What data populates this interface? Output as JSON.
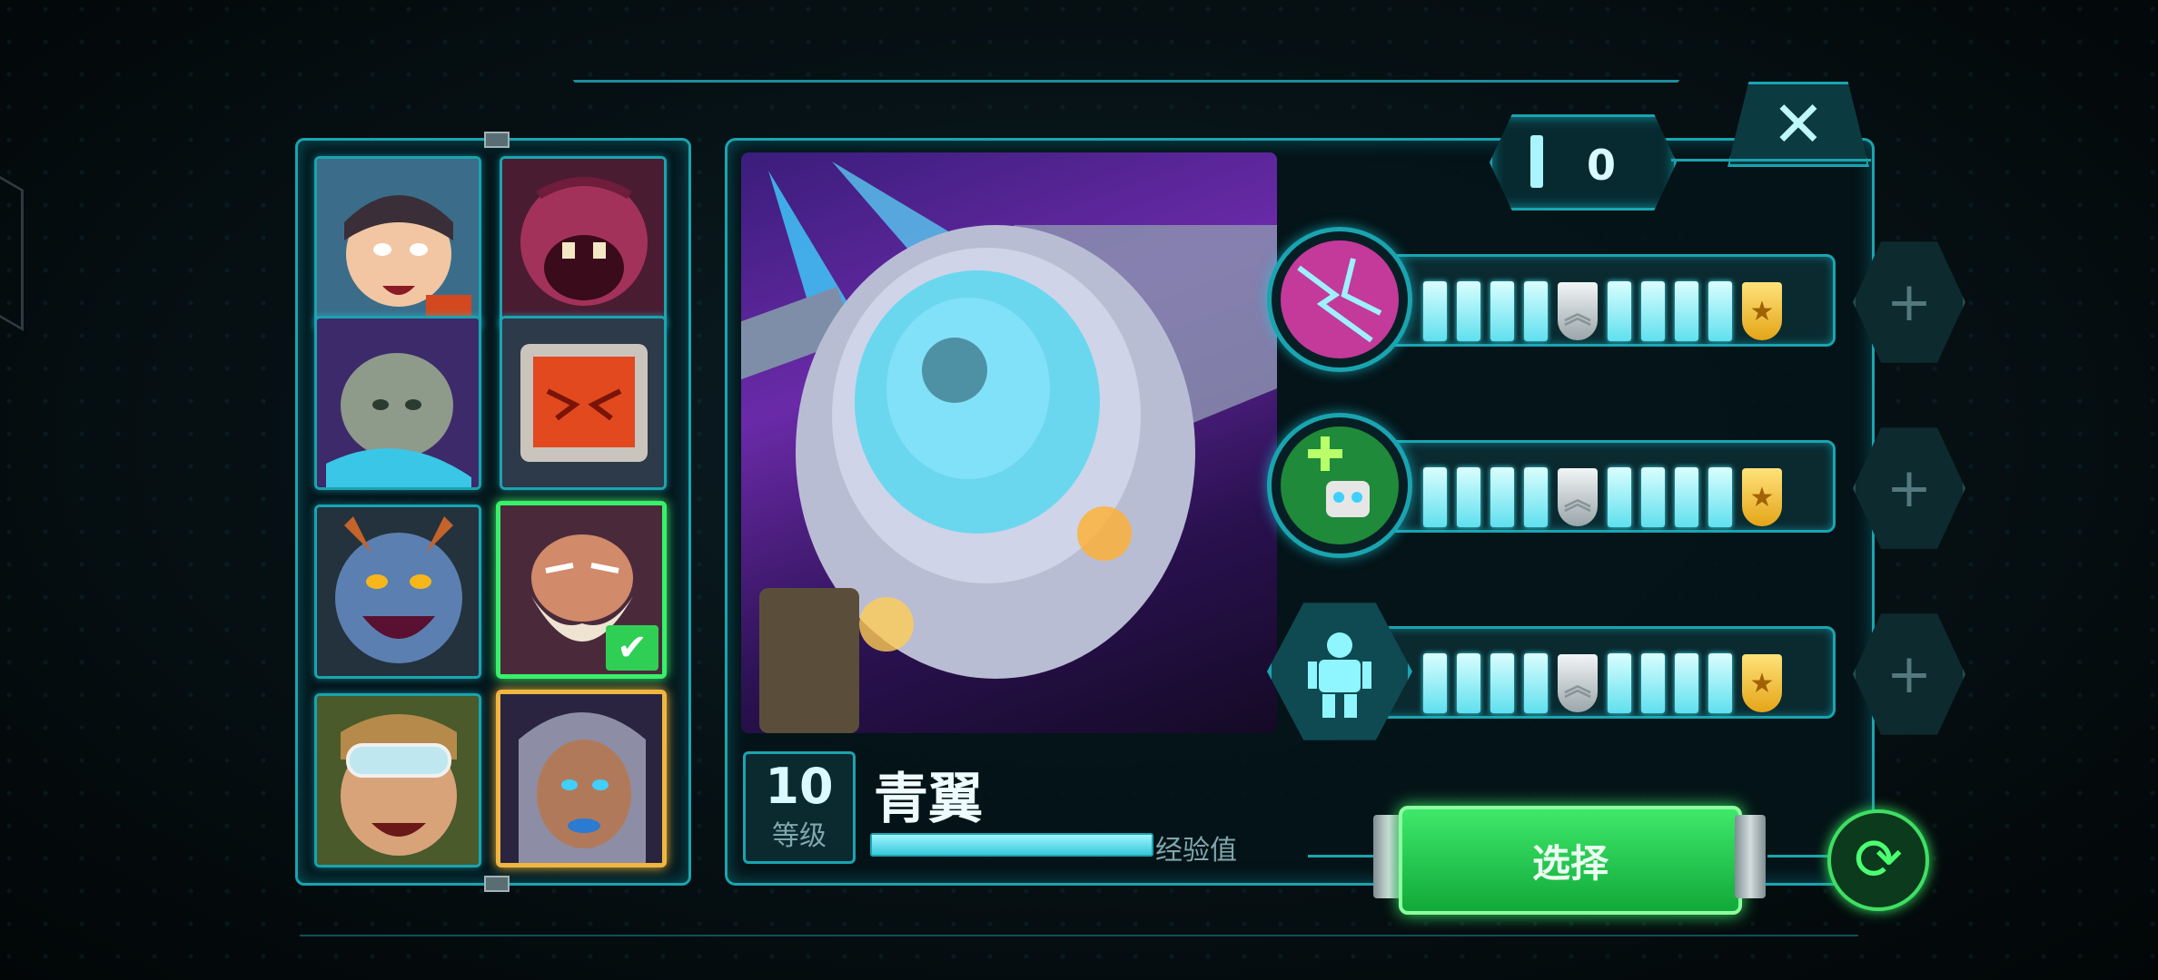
{
  "header": {
    "counter_value": "0",
    "close_label": "✕"
  },
  "roster": {
    "slots": [
      {
        "name": "hero-girl-angry",
        "state": "normal"
      },
      {
        "name": "hero-purple-monster",
        "state": "normal"
      },
      {
        "name": "hero-rock-golem",
        "state": "normal"
      },
      {
        "name": "hero-tv-robot",
        "state": "normal"
      },
      {
        "name": "hero-blue-troll",
        "state": "normal"
      },
      {
        "name": "hero-old-bearded",
        "state": "selected"
      },
      {
        "name": "hero-pilot-goggles",
        "state": "normal"
      },
      {
        "name": "hero-blue-lips-woman",
        "state": "gold"
      }
    ],
    "check_mark": "✔"
  },
  "hero": {
    "level": "10",
    "level_label": "等级",
    "name": "青翼",
    "xp_label": "经验值",
    "xp_progress": 1.0
  },
  "abilities": [
    {
      "icon": "lightning-orb-icon",
      "level": 4
    },
    {
      "icon": "heal-drone-icon",
      "level": 4
    },
    {
      "icon": "robot-armor-icon",
      "level": 4
    }
  ],
  "actions": {
    "select_label": "选择",
    "refresh_icon": "⟳",
    "plus_label": "+"
  },
  "colors": {
    "accent": "#1aa4b0",
    "select_green": "#2fd95a",
    "gold": "#f0b640"
  }
}
